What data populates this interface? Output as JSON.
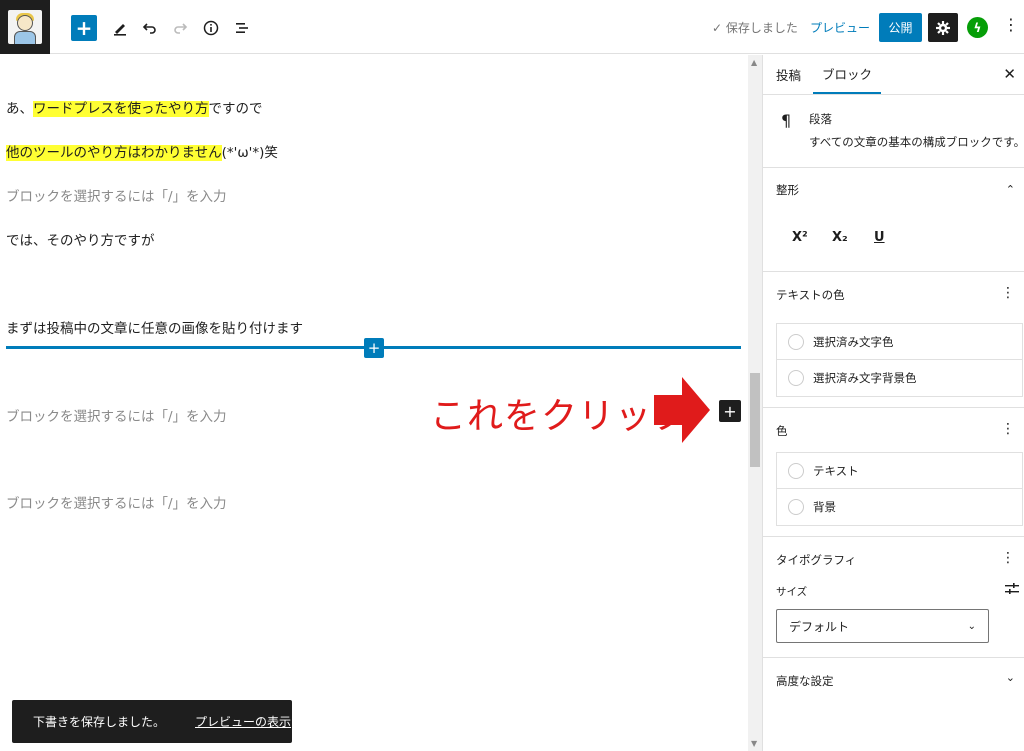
{
  "toolbar": {
    "saved_text": "✓ 保存しました",
    "preview_label": "プレビュー",
    "publish_label": "公開"
  },
  "editor": {
    "paragraphs": [
      {
        "before": "あ、",
        "highlight": "ワードプレスを使ったやり方",
        "after": "ですので"
      },
      {
        "before": "",
        "highlight": "他のツールのやり方はわかりません",
        "after": "(*'ω'*)笑"
      }
    ],
    "placeholder": "ブロックを選択するには「/」を入力",
    "line_3": "では、そのやり方ですが",
    "line_4": "まずは投稿中の文章に任意の画像を貼り付けます",
    "annotation": "これをクリック"
  },
  "snackbar": {
    "message": "下書きを保存しました。",
    "link": "プレビューの表示"
  },
  "sidebar": {
    "tabs": [
      "投稿",
      "ブロック"
    ],
    "block": {
      "name": "段落",
      "description": "すべての文章の基本の構成ブロックです。"
    },
    "formatting": {
      "title": "整形",
      "buttons": [
        "X²",
        "X₂",
        "U"
      ]
    },
    "text_color": {
      "title": "テキストの色",
      "options": [
        "選択済み文字色",
        "選択済み文字背景色"
      ]
    },
    "color": {
      "title": "色",
      "options": [
        "テキスト",
        "背景"
      ]
    },
    "typography": {
      "title": "タイポグラフィ",
      "size_label": "サイズ",
      "size_value": "デフォルト"
    },
    "advanced": {
      "title": "高度な設定"
    }
  },
  "colors": {
    "accent": "#007cba",
    "highlight": "#ffff33",
    "annotation": "#e01b1b",
    "dark": "#1e1e1e"
  }
}
